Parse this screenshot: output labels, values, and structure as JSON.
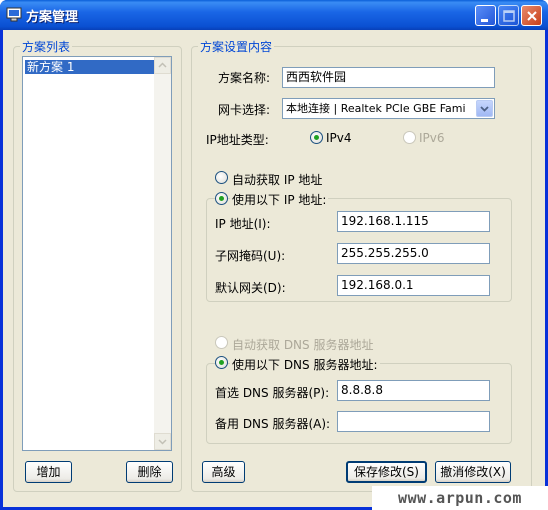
{
  "window": {
    "title": "方案管理",
    "icon": "monitor-icon"
  },
  "left_panel": {
    "group_label": "方案列表",
    "items": [
      "新方案 1"
    ],
    "add_button": "增加",
    "delete_button": "删除"
  },
  "right_panel": {
    "group_label": "方案设置内容",
    "scheme_name_label": "方案名称:",
    "scheme_name_value": "西西软件园",
    "nic_label": "网卡选择:",
    "nic_value": "本地连接 | Realtek PCIe GBE Fami",
    "ip_type_label": "IP地址类型:",
    "ipv4_label": "IPv4",
    "ipv6_label": "IPv6",
    "auto_ip_label": "自动获取 IP 地址",
    "manual_ip_label": "使用以下 IP 地址:",
    "ip_label": "IP  地址(I):",
    "ip_value": "192.168.1.115",
    "mask_label": "子网掩码(U):",
    "mask_value": "255.255.255.0",
    "gateway_label": "默认网关(D):",
    "gateway_value": "192.168.0.1",
    "auto_dns_label": "自动获取 DNS 服务器地址",
    "manual_dns_label": "使用以下 DNS 服务器地址:",
    "preferred_dns_label": "首选 DNS 服务器(P):",
    "preferred_dns_value": "8.8.8.8",
    "alternate_dns_label": "备用 DNS 服务器(A):",
    "alternate_dns_value": ""
  },
  "buttons": {
    "advanced": "高级",
    "save": "保存修改(S)",
    "cancel": "撤消修改(X)"
  },
  "watermark": "www.arpun.com"
}
